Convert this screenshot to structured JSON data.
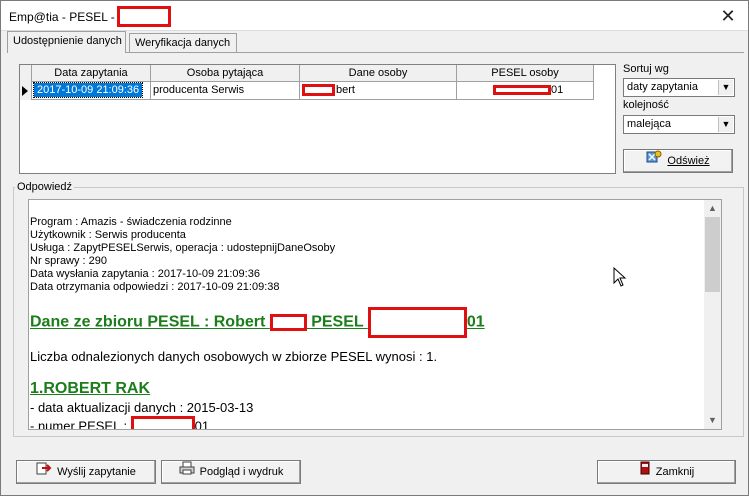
{
  "window": {
    "title": "Emp@tia - PESEL - R",
    "close": "✕"
  },
  "tabs": [
    {
      "label": "Udostępnienie danych",
      "active": true
    },
    {
      "label": "Weryfikacja danych",
      "active": false
    }
  ],
  "grid": {
    "columns": [
      "Data zapytania",
      "Osoba pytająca",
      "Dane osoby",
      "PESEL osoby"
    ],
    "rows": [
      {
        "data_zapytania": "2017-10-09 21:09:36",
        "osoba_pytajaca": "producenta Serwis",
        "dane_osoby": "bert",
        "pesel_osoby": "01"
      }
    ]
  },
  "side": {
    "sort_label": "Sortuj wg",
    "sort_value": "daty zapytania",
    "order_label": "kolejność",
    "order_value": "malejąca",
    "refresh_label": "Odśwież"
  },
  "response": {
    "group_label": "Odpowiedź",
    "meta": [
      "Program : Amazis - świadczenia rodzinne",
      "Użytkownik : Serwis producenta",
      "Usługa : ZapytPESELSerwis, operacja : udostepnijDaneOsoby",
      "Nr sprawy : 290",
      "Data wysłania zapytania : 2017-10-09 21:09:36",
      "Data otrzymania odpowiedzi : 2017-10-09 21:09:38"
    ],
    "heading_part1": "Dane ze zbioru PESEL : Robert ",
    "heading_part2": " PESEL ",
    "heading_part3": "01",
    "count_line": "Liczba odnalezionych danych osobowych w zbiorze PESEL wynosi : 1.",
    "person_heading": "1.ROBERT RAK",
    "detail_update": "- data aktualizacji danych : 2015-03-13",
    "detail_pesel_prefix": "- numer PESEL : ",
    "detail_pesel_suffix": "01"
  },
  "buttons": {
    "send": "Wyślij zapytanie",
    "preview": "Podgląd i wydruk",
    "close": "Zamknij"
  },
  "colors": {
    "selection": "#0078d7",
    "heading_green": "#1b7d1b",
    "redaction": "#e01010"
  }
}
